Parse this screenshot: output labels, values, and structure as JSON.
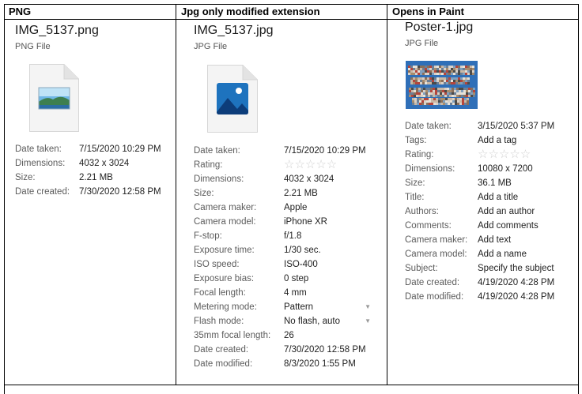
{
  "headers": [
    "PNG",
    "Jpg only modified extension",
    "Opens in Paint"
  ],
  "col1": {
    "filename": "IMG_5137.png",
    "filetype": "PNG File",
    "icon": "png-file-icon",
    "props": [
      {
        "label": "Date taken:",
        "value": "7/15/2020 10:29 PM"
      },
      {
        "label": "Dimensions:",
        "value": "4032 x 3024"
      },
      {
        "label": "Size:",
        "value": "2.21 MB"
      },
      {
        "label": "Date created:",
        "value": "7/30/2020 12:58 PM"
      }
    ]
  },
  "col2": {
    "filename": "IMG_5137.jpg",
    "filetype": "JPG File",
    "icon": "jpg-file-icon",
    "props": [
      {
        "label": "Date taken:",
        "value": "7/15/2020 10:29 PM"
      },
      {
        "label": "Rating:",
        "value": ""
      },
      {
        "label": "Dimensions:",
        "value": "4032 x 3024"
      },
      {
        "label": "Size:",
        "value": "2.21 MB"
      },
      {
        "label": "Camera maker:",
        "value": "Apple"
      },
      {
        "label": "Camera model:",
        "value": "iPhone XR"
      },
      {
        "label": "F-stop:",
        "value": "f/1.8"
      },
      {
        "label": "Exposure time:",
        "value": "1/30 sec."
      },
      {
        "label": "ISO speed:",
        "value": "ISO-400"
      },
      {
        "label": "Exposure bias:",
        "value": "0 step"
      },
      {
        "label": "Focal length:",
        "value": "4 mm"
      },
      {
        "label": "Metering mode:",
        "value": "Pattern"
      },
      {
        "label": "Flash mode:",
        "value": "No flash, auto"
      },
      {
        "label": "35mm focal length:",
        "value": "26"
      },
      {
        "label": "Date created:",
        "value": "7/30/2020 12:58 PM"
      },
      {
        "label": "Date modified:",
        "value": "8/3/2020 1:55 PM"
      }
    ],
    "rating_stars": 0
  },
  "col3": {
    "filename": "Poster-1.jpg",
    "filetype": "JPG File",
    "icon": "poster-thumbnail",
    "props": [
      {
        "label": "Date taken:",
        "value": "3/15/2020 5:37 PM"
      },
      {
        "label": "Tags:",
        "value": "Add a tag"
      },
      {
        "label": "Rating:",
        "value": ""
      },
      {
        "label": "Dimensions:",
        "value": "10080 x 7200"
      },
      {
        "label": "Size:",
        "value": "36.1 MB"
      },
      {
        "label": "Title:",
        "value": "Add a title"
      },
      {
        "label": "Authors:",
        "value": "Add an author"
      },
      {
        "label": "Comments:",
        "value": "Add comments"
      },
      {
        "label": "Camera maker:",
        "value": "Add text"
      },
      {
        "label": "Camera model:",
        "value": "Add a name"
      },
      {
        "label": "Subject:",
        "value": "Specify the subject"
      },
      {
        "label": "Date created:",
        "value": "4/19/2020 4:28 PM"
      },
      {
        "label": "Date modified:",
        "value": "4/19/2020 4:28 PM"
      }
    ],
    "rating_stars": 0
  },
  "colors": {
    "border": "#000000",
    "label": "#5c5c5c",
    "value": "#1f1f1f",
    "star": "#d0d0d0",
    "jpg_blue": "#1e73be"
  }
}
